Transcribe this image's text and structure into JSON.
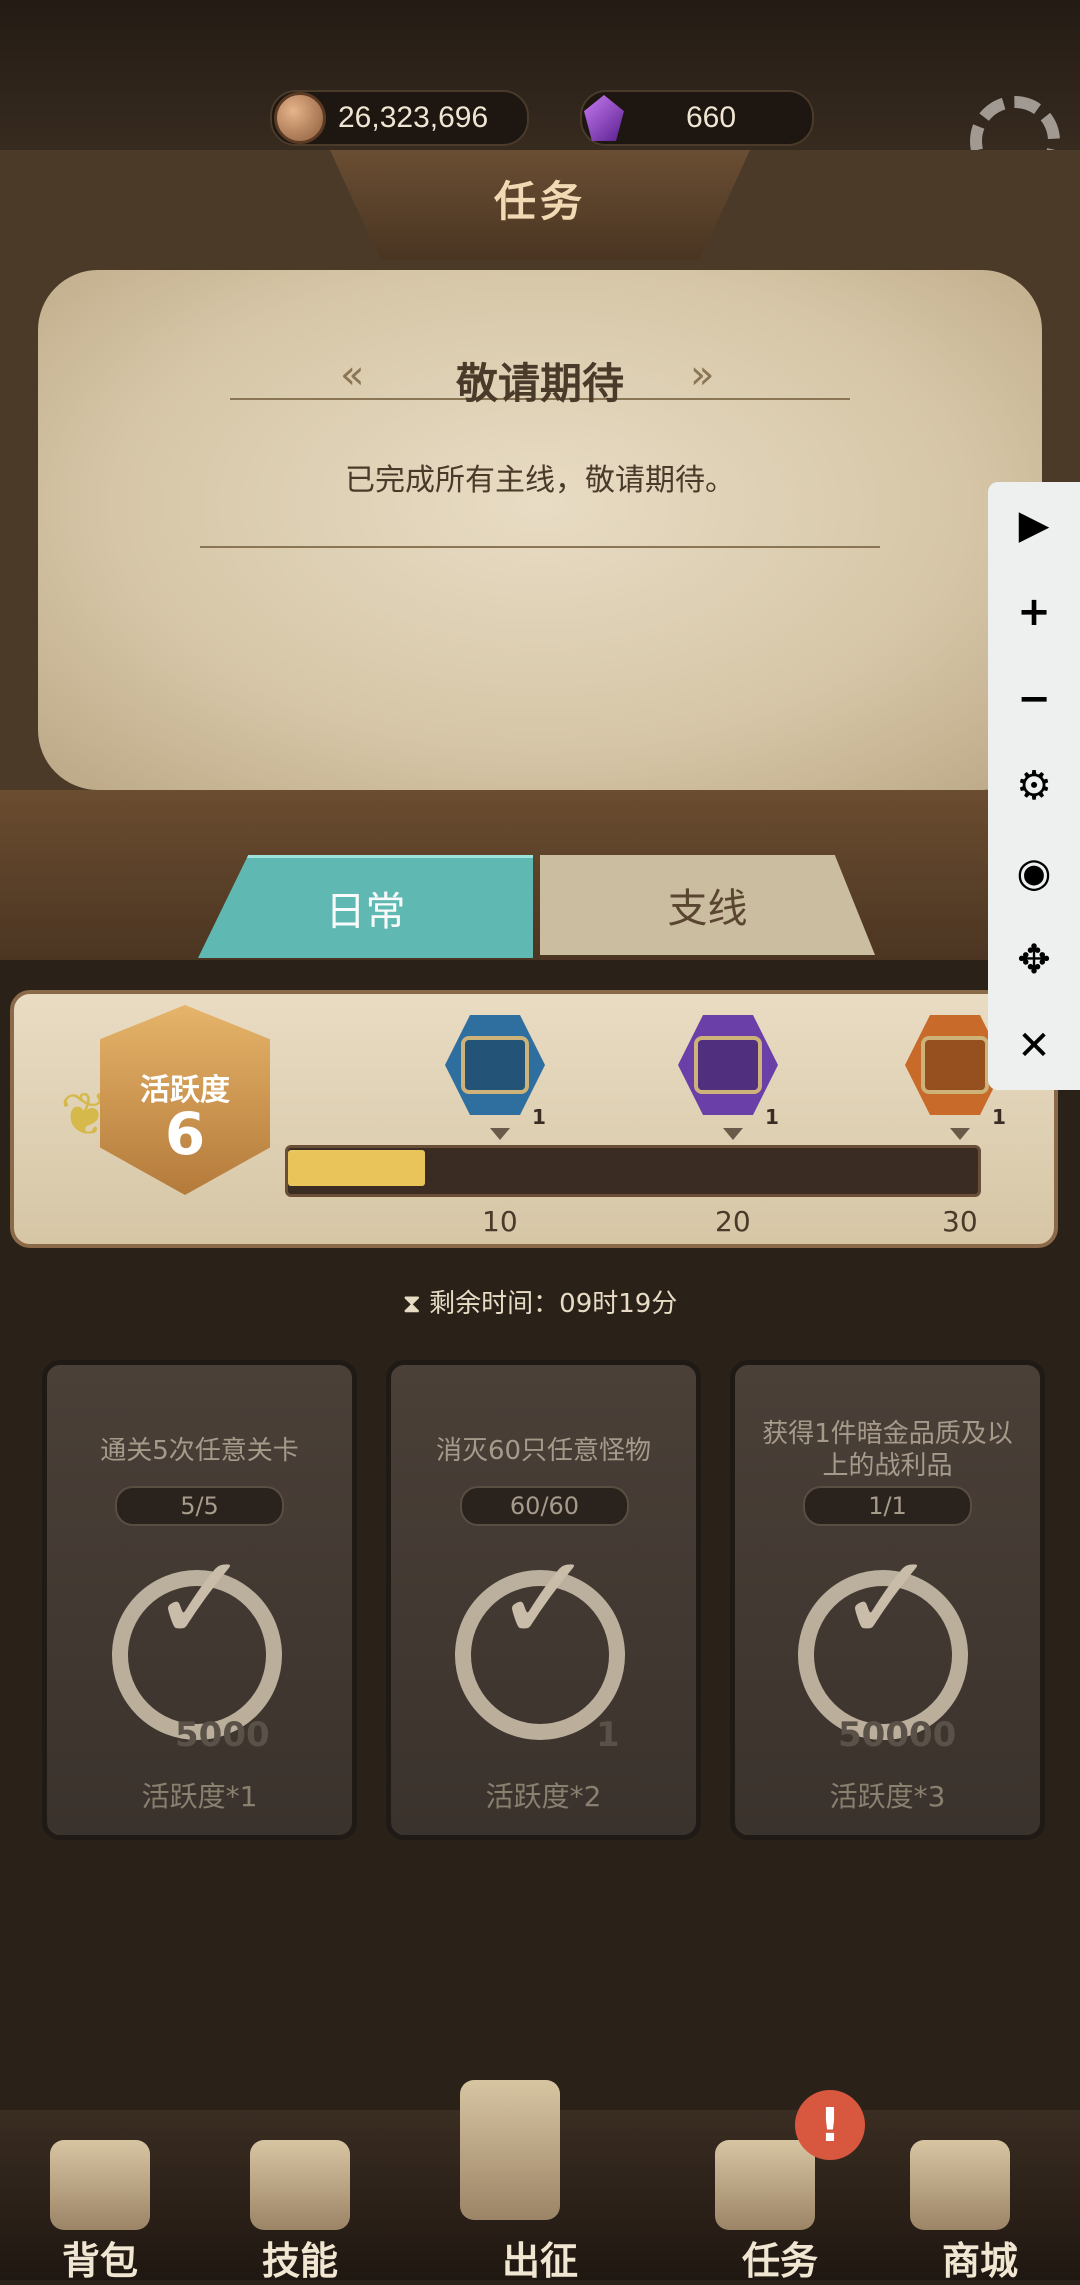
{
  "currency": {
    "coins": "26,323,696",
    "gems": "660"
  },
  "header": {
    "title": "任务"
  },
  "main_quest": {
    "title": "敬请期待",
    "description": "已完成所有主线，敬请期待。"
  },
  "tabs": [
    {
      "label": "日常",
      "active": true
    },
    {
      "label": "支线",
      "active": false
    }
  ],
  "activity": {
    "label": "活跃度",
    "value": "6",
    "progress": 0.2,
    "milestones": [
      {
        "threshold": "10",
        "chest_count": "1",
        "color": "#2f6f9f"
      },
      {
        "threshold": "20",
        "chest_count": "1",
        "color": "#6a3fa8"
      },
      {
        "threshold": "30",
        "chest_count": "1",
        "color": "#c86a2a"
      }
    ]
  },
  "timer": {
    "text": "剩余时间：09时19分"
  },
  "tasks": [
    {
      "title": "通关5次任意关卡",
      "progress": "5/5",
      "reward_amount": "5000",
      "activity_reward": "活跃度*1"
    },
    {
      "title": "消灭60只任意怪物",
      "progress": "60/60",
      "reward_amount": "1",
      "activity_reward": "活跃度*2"
    },
    {
      "title": "获得1件暗金品质及以上的战利品",
      "progress": "1/1",
      "reward_amount": "50000",
      "activity_reward": "活跃度*3"
    }
  ],
  "nav": [
    {
      "label": "背包",
      "icon": "backpack-icon"
    },
    {
      "label": "技能",
      "icon": "skill-book-icon"
    },
    {
      "label": "出征",
      "icon": "sword-icon"
    },
    {
      "label": "任务",
      "icon": "horn-icon"
    },
    {
      "label": "商城",
      "icon": "shop-icon"
    }
  ],
  "nav_alert": "!",
  "toolbar": [
    {
      "icon": "play-icon",
      "glyph": "▶"
    },
    {
      "icon": "zoom-in-icon",
      "glyph": "+"
    },
    {
      "icon": "zoom-out-icon",
      "glyph": "−"
    },
    {
      "icon": "settings-icon",
      "glyph": "⚙"
    },
    {
      "icon": "eye-icon",
      "glyph": "◉"
    },
    {
      "icon": "move-icon",
      "glyph": "✥"
    },
    {
      "icon": "close-icon",
      "glyph": "✕"
    }
  ],
  "colors": {
    "tab_active": "#5fb8b1",
    "progress_fill": "#e9c45a",
    "alert": "#d8573f"
  }
}
